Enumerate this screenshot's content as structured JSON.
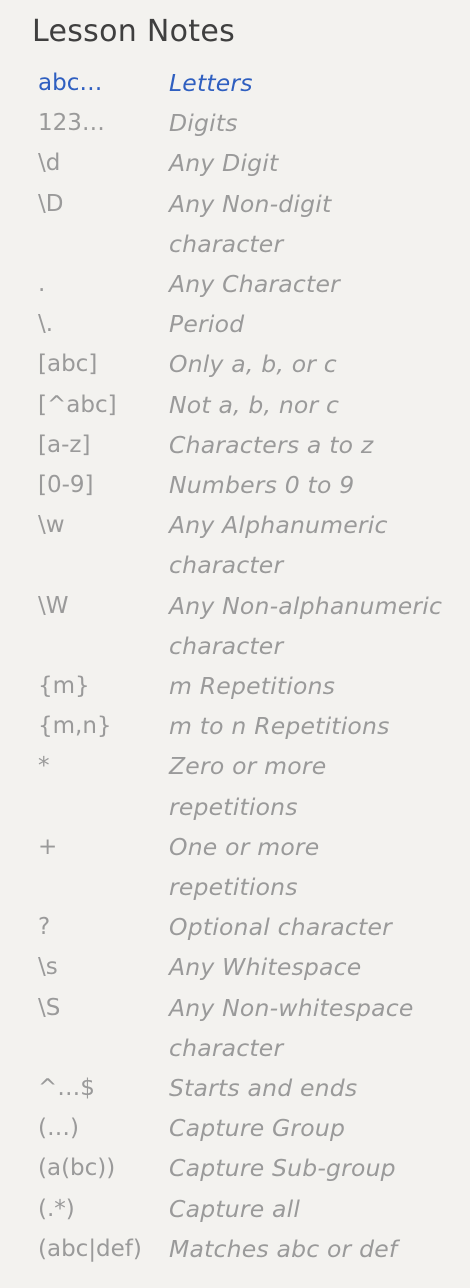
{
  "title": "Lesson Notes",
  "accent_color": "#2f5fc0",
  "text_color": "#9a9a9a",
  "notes": [
    {
      "symbol": "abc…",
      "lines": [
        "Letters"
      ],
      "active": true
    },
    {
      "symbol": "123…",
      "lines": [
        "Digits"
      ]
    },
    {
      "symbol": "\\d",
      "lines": [
        "Any Digit"
      ]
    },
    {
      "symbol": "\\D",
      "lines": [
        "Any Non-digit",
        "character"
      ]
    },
    {
      "symbol": ".",
      "lines": [
        "Any Character"
      ]
    },
    {
      "symbol": "\\.",
      "lines": [
        "Period"
      ]
    },
    {
      "symbol": "[abc]",
      "lines": [
        "Only a, b, or c"
      ]
    },
    {
      "symbol": "[^abc]",
      "lines": [
        "Not a, b, nor c"
      ]
    },
    {
      "symbol": "[a-z]",
      "lines": [
        "Characters a to z"
      ]
    },
    {
      "symbol": "[0-9]",
      "lines": [
        "Numbers 0 to 9"
      ]
    },
    {
      "symbol": "\\w",
      "lines": [
        "Any Alphanumeric",
        "character"
      ]
    },
    {
      "symbol": "\\W",
      "lines": [
        "Any Non-alphanumeric",
        "character"
      ]
    },
    {
      "symbol": "{m}",
      "lines": [
        "m Repetitions"
      ]
    },
    {
      "symbol": "{m,n}",
      "lines": [
        "m to n Repetitions"
      ]
    },
    {
      "symbol": "*",
      "lines": [
        "Zero or more",
        "repetitions"
      ]
    },
    {
      "symbol": "+",
      "lines": [
        "One or more",
        "repetitions"
      ]
    },
    {
      "symbol": "?",
      "lines": [
        "Optional character"
      ]
    },
    {
      "symbol": "\\s",
      "lines": [
        "Any Whitespace"
      ]
    },
    {
      "symbol": "\\S",
      "lines": [
        "Any Non-whitespace",
        "character"
      ]
    },
    {
      "symbol": "^…$",
      "lines": [
        "Starts and ends"
      ]
    },
    {
      "symbol": "(…)",
      "lines": [
        "Capture Group"
      ]
    },
    {
      "symbol": "(a(bc))",
      "lines": [
        "Capture Sub-group"
      ]
    },
    {
      "symbol": "(.*)",
      "lines": [
        "Capture all"
      ]
    },
    {
      "symbol": "(abc|def)",
      "lines": [
        "Matches abc or def"
      ]
    }
  ]
}
